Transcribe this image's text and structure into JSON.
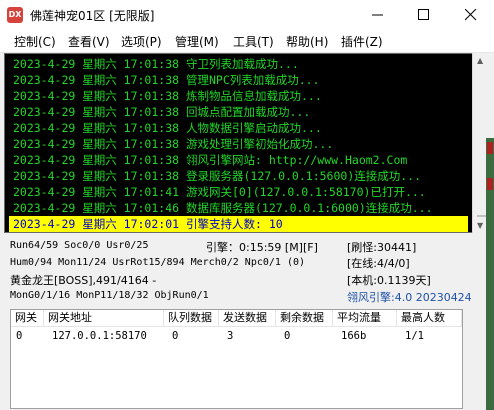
{
  "window": {
    "app_icon_text": "DX",
    "title": "佛莲神宠01区 [无限版]"
  },
  "menu": [
    {
      "label": "控制(C)"
    },
    {
      "label": "查看(V)"
    },
    {
      "label": "选项(P)"
    },
    {
      "label": "管理(M)"
    },
    {
      "label": "工具(T)"
    },
    {
      "label": "帮助(H)"
    },
    {
      "label": "插件(Z)"
    }
  ],
  "log": [
    "2023-4-29 星期六 17:01:38 守卫列表加载成功...",
    "2023-4-29 星期六 17:01:38 管理NPC列表加载成功...",
    "2023-4-29 星期六 17:01:38 炼制物品信息加载成功...",
    "2023-4-29 星期六 17:01:38 回城点配置加载成功...",
    "2023-4-29 星期六 17:01:38 人物数据引擎启动成功...",
    "2023-4-29 星期六 17:01:38 游戏处理引擎初始化成功...",
    "2023-4-29 星期六 17:01:38 翎风引擎网站: http://www.Haom2.Com",
    "2023-4-29 星期六 17:01:38 登录服务器(127.0.0.1:5600)连接成功...",
    "2023-4-29 星期六 17:01:41 游戏网关[0](127.0.0.1:58170)已打开...",
    "2023-4-29 星期六 17:01:46 数据库服务器(127.0.0.1:6000)连接成功...",
    "2023-4-29 星期六 17:02:01 引擎支持人数: 10"
  ],
  "status": {
    "run": "Run64/59 Soc0/0 Usr0/25",
    "engine_time": "引擎：0:15:59 [M][F]",
    "refresh": "[刷怪:30441]",
    "hum": "Hum0/94 Mon11/24 UsrRot15/894 Merch0/2 Npc0/1 (0)",
    "online": "[在线:4/4/0]",
    "boss": "黄金龙王[BOSS],491/4164 -",
    "uptime": "[本机:0.1139天]",
    "mon": "MonG0/1/16 MonP11/18/32 ObjRun0/1",
    "version": "翎风引擎:4.0 20230424"
  },
  "table": {
    "headers": [
      "网关",
      "网关地址",
      "队列数据",
      "发送数据",
      "剩余数据",
      "平均流量",
      "最高人数"
    ],
    "rows": [
      [
        "0",
        "127.0.0.1:58170",
        "0",
        "3",
        "0",
        "166b",
        "1/1"
      ]
    ]
  }
}
